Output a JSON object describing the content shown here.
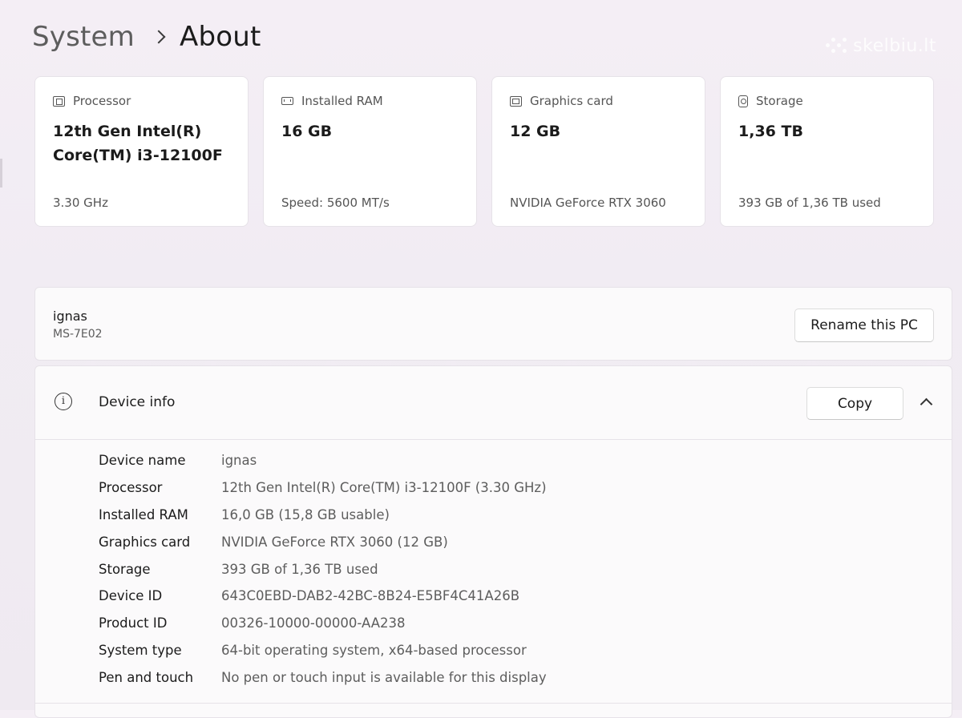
{
  "breadcrumb": {
    "parent": "System",
    "current": "About"
  },
  "watermark": "skelbiu.lt",
  "cards": [
    {
      "icon": "processor-icon",
      "label": "Processor",
      "value": "12th Gen Intel(R) Core(TM) i3-12100F",
      "sub": "3.30 GHz"
    },
    {
      "icon": "ram-icon",
      "label": "Installed RAM",
      "value": "16 GB",
      "sub": "Speed: 5600 MT/s"
    },
    {
      "icon": "graphics-card-icon",
      "label": "Graphics card",
      "value": "12 GB",
      "sub": "NVIDIA GeForce RTX 3060"
    },
    {
      "icon": "storage-icon",
      "label": "Storage",
      "value": "1,36 TB",
      "sub": "393 GB of 1,36 TB used"
    }
  ],
  "pc": {
    "name": "ignas",
    "model": "MS-7E02",
    "rename_label": "Rename this PC"
  },
  "device_info": {
    "title": "Device info",
    "copy_label": "Copy",
    "specs": [
      {
        "label": "Device name",
        "value": "ignas"
      },
      {
        "label": "Processor",
        "value": "12th Gen Intel(R) Core(TM) i3-12100F (3.30 GHz)"
      },
      {
        "label": "Installed RAM",
        "value": "16,0 GB (15,8 GB usable)"
      },
      {
        "label": "Graphics card",
        "value": "NVIDIA GeForce RTX 3060 (12 GB)"
      },
      {
        "label": "Storage",
        "value": "393 GB of 1,36 TB used"
      },
      {
        "label": "Device ID",
        "value": "643C0EBD-DAB2-42BC-8B24-E5BF4C41A26B"
      },
      {
        "label": "Product ID",
        "value": "00326-10000-00000-AA238"
      },
      {
        "label": "System type",
        "value": "64-bit operating system, x64-based processor"
      },
      {
        "label": "Pen and touch",
        "value": "No pen or touch input is available for this display"
      }
    ]
  },
  "colors": {
    "background": "#f2edf3",
    "card": "#ffffff",
    "text_primary": "#1b1b1b",
    "text_secondary": "#5d5d5d"
  }
}
